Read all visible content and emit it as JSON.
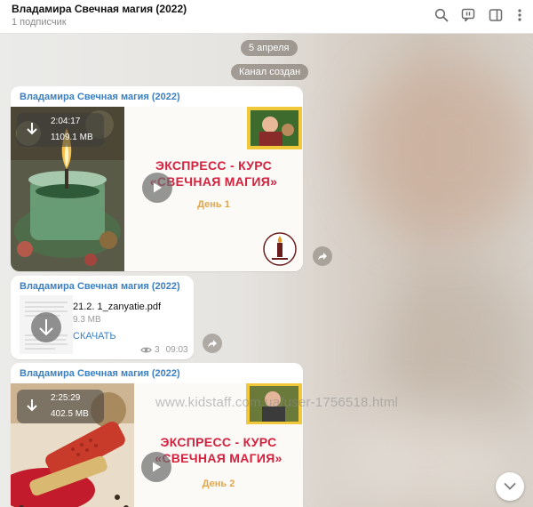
{
  "header": {
    "title": "Владамира Свечная магия (2022)",
    "subtitle": "1 подписчик",
    "icons": [
      "search-icon",
      "live-stream-icon",
      "sidebar-toggle-icon",
      "more-vertical-icon"
    ]
  },
  "service": {
    "date": "5 апреля",
    "created": "Канал создан"
  },
  "messages": [
    {
      "author": "Владамира Свечная магия (2022)",
      "duration": "2:04:17",
      "size": "1109.1 MB",
      "course_title": "ЭКСПРЕСС - КУРС\n«СВЕЧНАЯ МАГИЯ»",
      "day": "День 1"
    },
    {
      "author": "Владамира Свечная магия (2022)",
      "file_name": "21.2. 1_zanyatie.pdf",
      "file_size": "9.3 MB",
      "download_label": "СКАЧАТЬ",
      "views": "3",
      "time": "09:03"
    },
    {
      "author": "Владамира Свечная магия (2022)",
      "duration": "2:25:29",
      "size": "402.5 MB",
      "course_title": "ЭКСПРЕСС - КУРС\n«СВЕЧНАЯ МАГИЯ»",
      "day": "День 2"
    }
  ],
  "watermark": "www.kidstaff.com.ua/user-1756518.html",
  "colors": {
    "accent": "#3a7fc2",
    "course_red": "#d4213d",
    "day_gold": "#e0a64d"
  }
}
